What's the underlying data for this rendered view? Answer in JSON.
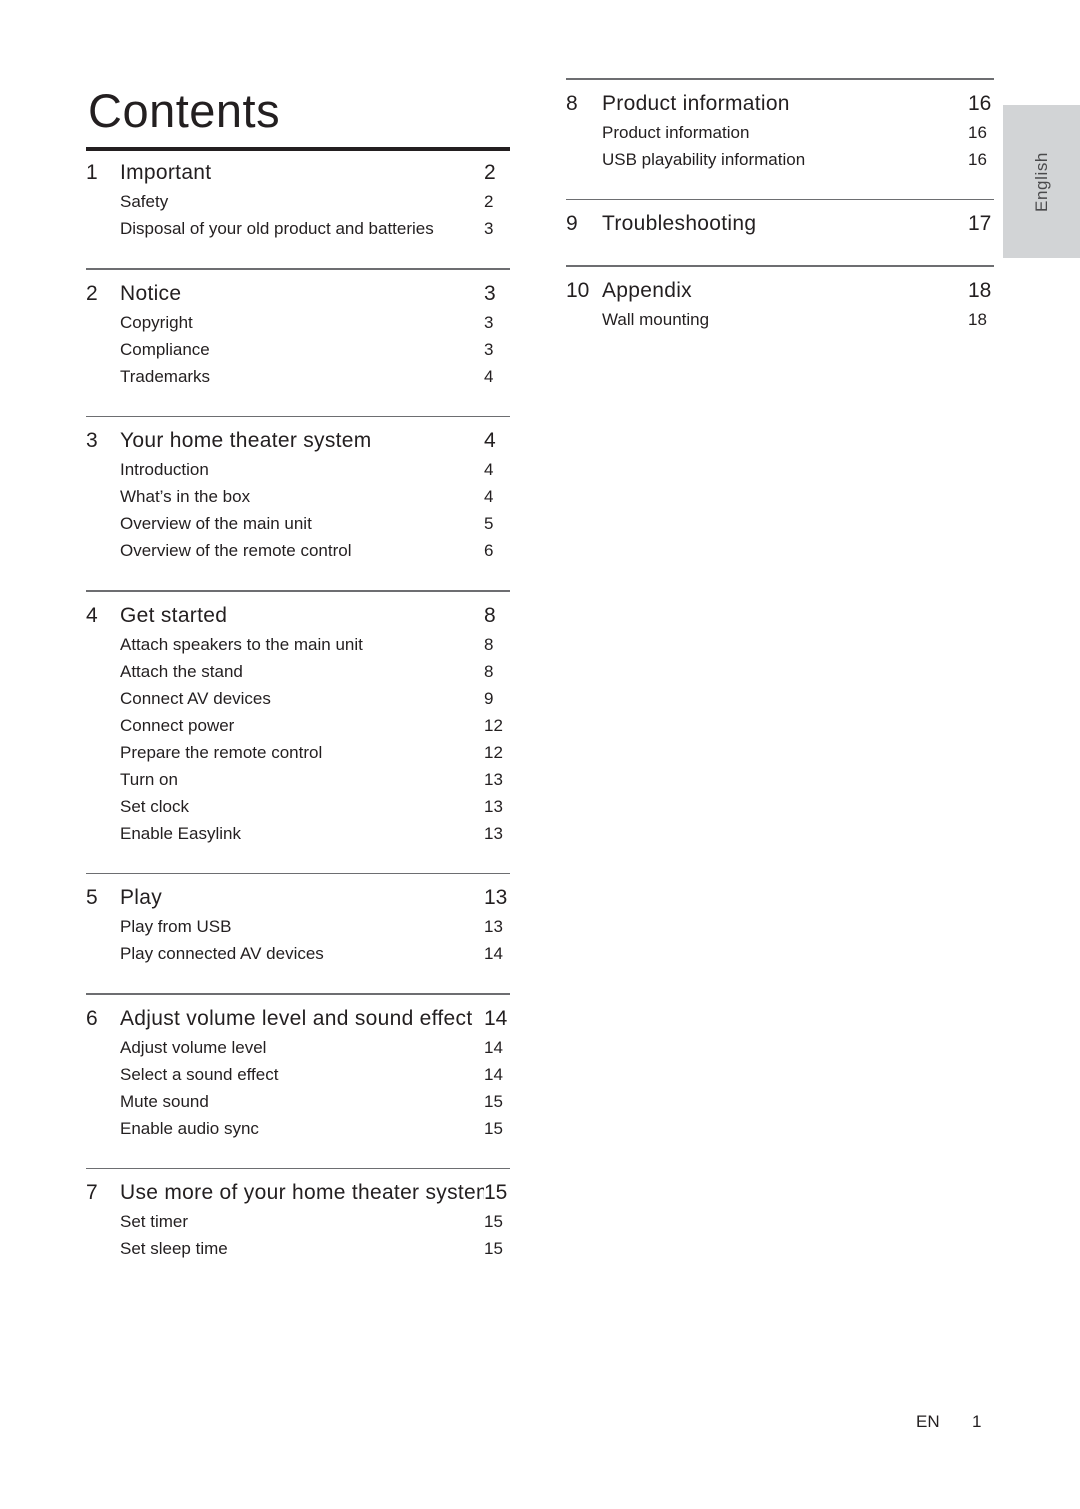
{
  "page": {
    "title": "Contents",
    "language_tab": "English",
    "footer": {
      "language_code": "EN",
      "page_number": "1"
    }
  },
  "toc": {
    "left_column": [
      {
        "number": "1",
        "title": "Important",
        "page": "2",
        "entries": [
          {
            "title": "Safety",
            "page": "2"
          },
          {
            "title": "Disposal of your old product and batteries",
            "page": "3"
          }
        ]
      },
      {
        "number": "2",
        "title": "Notice",
        "page": "3",
        "entries": [
          {
            "title": "Copyright",
            "page": "3"
          },
          {
            "title": "Compliance",
            "page": "3"
          },
          {
            "title": "Trademarks",
            "page": "4"
          }
        ]
      },
      {
        "number": "3",
        "title": "Your home theater system",
        "page": "4",
        "entries": [
          {
            "title": "Introduction",
            "page": "4"
          },
          {
            "title": "What’s in the box",
            "page": "4"
          },
          {
            "title": "Overview of the main unit",
            "page": "5"
          },
          {
            "title": "Overview of the remote control",
            "page": "6"
          }
        ]
      },
      {
        "number": "4",
        "title": "Get started",
        "page": "8",
        "entries": [
          {
            "title": "Attach speakers to the main unit",
            "page": "8"
          },
          {
            "title": "Attach the stand",
            "page": "8"
          },
          {
            "title": "Connect AV devices",
            "page": "9"
          },
          {
            "title": "Connect power",
            "page": "12"
          },
          {
            "title": "Prepare the remote control",
            "page": "12"
          },
          {
            "title": "Turn on",
            "page": "13"
          },
          {
            "title": "Set clock",
            "page": "13"
          },
          {
            "title": "Enable Easylink",
            "page": "13"
          }
        ]
      },
      {
        "number": "5",
        "title": "Play",
        "page": "13",
        "entries": [
          {
            "title": "Play from USB",
            "page": "13"
          },
          {
            "title": "Play connected AV devices",
            "page": "14"
          }
        ]
      },
      {
        "number": "6",
        "title": "Adjust volume level and sound effect",
        "page": "14",
        "entries": [
          {
            "title": "Adjust volume level",
            "page": "14"
          },
          {
            "title": "Select a sound effect",
            "page": "14"
          },
          {
            "title": "Mute sound",
            "page": "15"
          },
          {
            "title": "Enable audio sync",
            "page": "15"
          }
        ]
      },
      {
        "number": "7",
        "title": "Use more of your home theater system",
        "page": "15",
        "entries": [
          {
            "title": "Set timer",
            "page": "15"
          },
          {
            "title": "Set sleep time",
            "page": "15"
          }
        ]
      }
    ],
    "right_column": [
      {
        "number": "8",
        "title": "Product information",
        "page": "16",
        "entries": [
          {
            "title": "Product information",
            "page": "16"
          },
          {
            "title": "USB playability information",
            "page": "16"
          }
        ]
      },
      {
        "number": "9",
        "title": "Troubleshooting",
        "page": "17",
        "entries": []
      },
      {
        "number": "10",
        "title": "Appendix",
        "page": "18",
        "entries": [
          {
            "title": "Wall mounting",
            "page": "18"
          }
        ]
      }
    ]
  },
  "colors": {
    "text": "#231f20",
    "rule_heavy": "#231f20",
    "rule_thin": "#6d6e71",
    "tab_background": "#d2d4d6"
  }
}
